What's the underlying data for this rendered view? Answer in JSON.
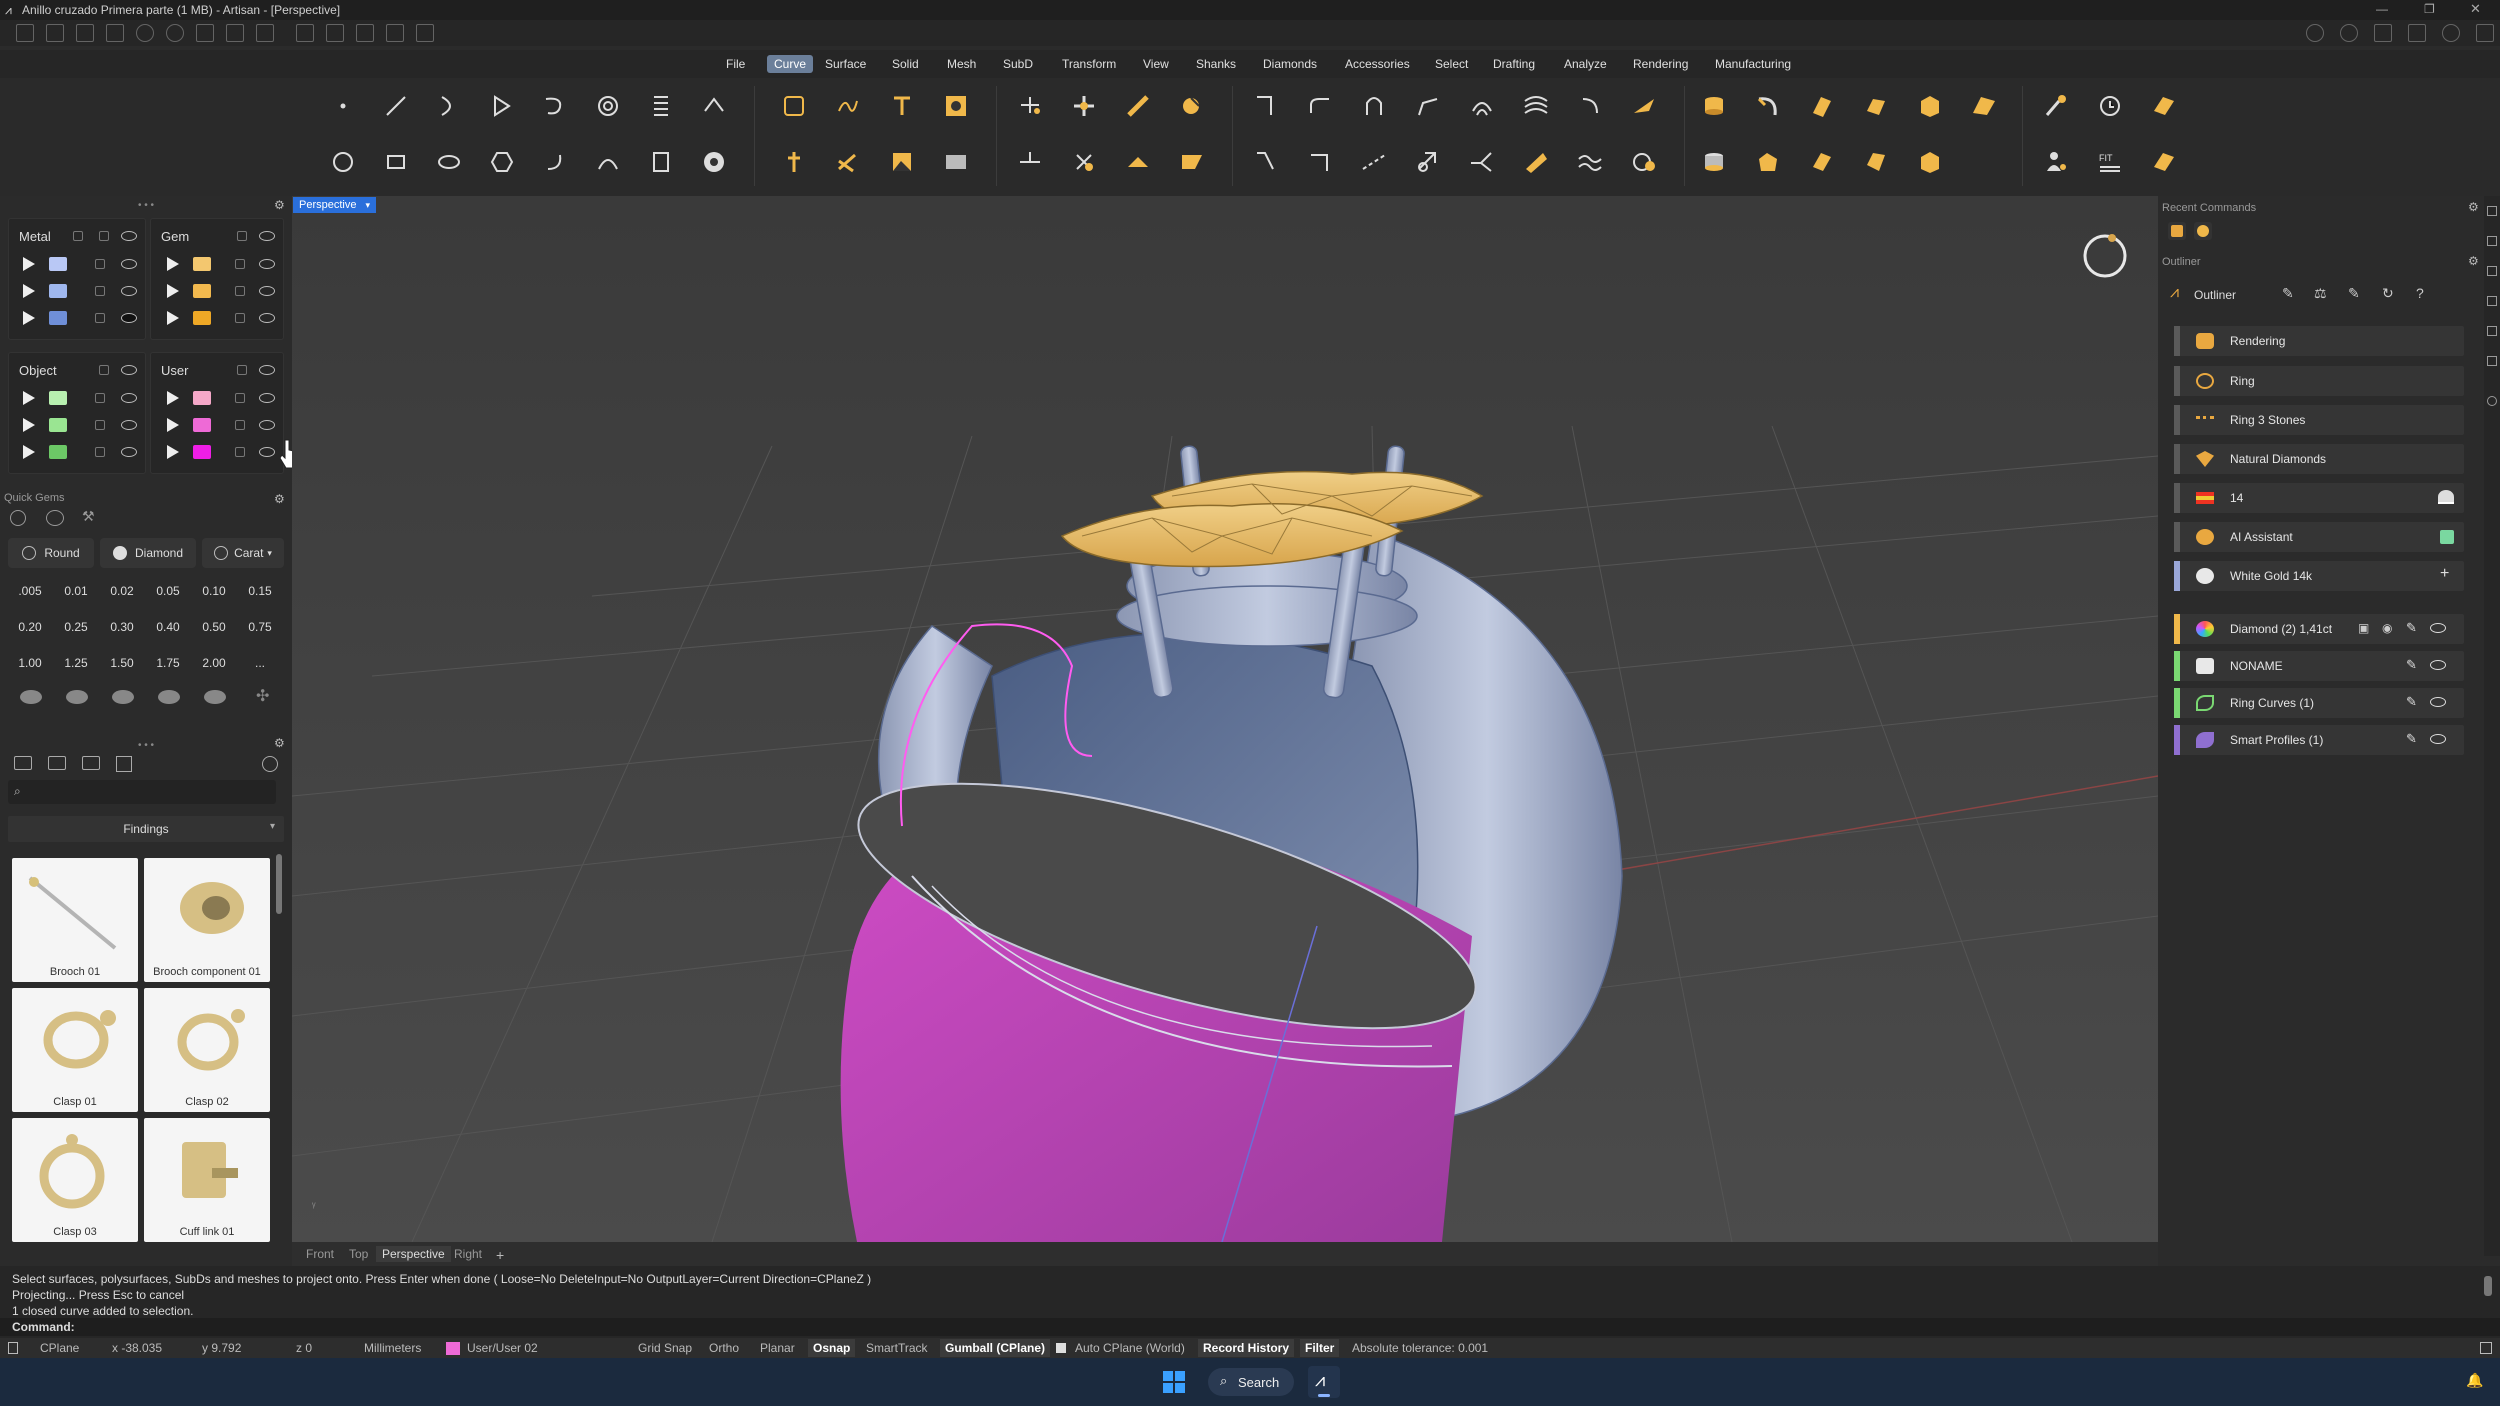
{
  "window": {
    "title": "Anillo cruzado Primera parte (1 MB) - Artisan - [Perspective]"
  },
  "menu": [
    "File",
    "Curve",
    "Surface",
    "Solid",
    "Mesh",
    "SubD",
    "Transform",
    "View",
    "Shanks",
    "Diamonds",
    "Accessories",
    "Select",
    "Drafting",
    "Analyze",
    "Rendering",
    "Manufacturing"
  ],
  "menu_active": "Curve",
  "layers": {
    "metal": {
      "title": "Metal",
      "colors": [
        "#b9c8f5",
        "#9fb7ee",
        "#6f8fd8"
      ]
    },
    "gem": {
      "title": "Gem",
      "colors": [
        "#f3c76f",
        "#f2b94e",
        "#eea826"
      ]
    },
    "object": {
      "title": "Object",
      "colors": [
        "#b8f0b0",
        "#9ae592",
        "#6cc866"
      ]
    },
    "user": {
      "title": "User",
      "colors": [
        "#f5a8c8",
        "#ee6ad6",
        "#ee1ee6"
      ]
    }
  },
  "quick_gems": {
    "title": "Quick Gems",
    "shape": "Round",
    "material": "Diamond",
    "unit": "Carat",
    "sizes": [
      ".005",
      "0.01",
      "0.02",
      "0.05",
      "0.10",
      "0.15",
      "0.20",
      "0.25",
      "0.30",
      "0.40",
      "0.50",
      "0.75",
      "1.00",
      "1.25",
      "1.50",
      "1.75",
      "2.00",
      "..."
    ]
  },
  "library": {
    "category": "Findings",
    "items": [
      "Brooch 01",
      "Brooch component 01",
      "Clasp 01",
      "Clasp 02",
      "Clasp 03",
      "Cuff link 01"
    ]
  },
  "viewport": {
    "label": "Perspective"
  },
  "view_tabs": [
    "Front",
    "Top",
    "Perspective",
    "Right"
  ],
  "view_tab_active": "Perspective",
  "right": {
    "recent_commands": "Recent Commands",
    "outliner_section": "Outliner",
    "outliner_title": "Outliner",
    "rows1": [
      {
        "label": "Rendering",
        "bar": "#5a5a5a"
      },
      {
        "label": "Ring",
        "bar": "#5a5a5a"
      },
      {
        "label": "Ring 3 Stones",
        "bar": "#5a5a5a"
      },
      {
        "label": "Natural Diamonds",
        "bar": "#5a5a5a"
      },
      {
        "label": "14",
        "bar": "#5a5a5a"
      },
      {
        "label": "AI Assistant",
        "bar": "#5a5a5a"
      },
      {
        "label": "White Gold 14k",
        "bar": "#9aa7d8"
      }
    ],
    "rows2": [
      {
        "label": "Diamond (2) 1,41ct",
        "bar": "#f0b84a"
      },
      {
        "label": "NONAME",
        "bar": "#7ad872"
      },
      {
        "label": "Ring Curves (1)",
        "bar": "#7ad872"
      },
      {
        "label": "Smart Profiles (1)",
        "bar": "#8f6fd0"
      }
    ]
  },
  "command": {
    "history": [
      "Select surfaces, polysurfaces, SubDs and meshes to project onto. Press Enter when done ( Loose=No  DeleteInput=No  OutputLayer=Current  Direction=CPlaneZ )",
      "Projecting... Press Esc to cancel",
      "1 closed curve added to selection."
    ],
    "prompt": "Command:"
  },
  "status": {
    "cplane": "CPlane",
    "x": "x -38.035",
    "y": "y 9.792",
    "z": "z 0",
    "units": "Millimeters",
    "layer": "User/User 02",
    "layer_color": "#ee6ad6",
    "grid_snap": "Grid Snap",
    "ortho": "Ortho",
    "planar": "Planar",
    "osnap": "Osnap",
    "smarttrack": "SmartTrack",
    "gumball": "Gumball (CPlane)",
    "auto_cplane": "Auto CPlane (World)",
    "record_history": "Record History",
    "filter": "Filter",
    "tolerance": "Absolute tolerance: 0.001"
  },
  "taskbar": {
    "search": "Search"
  }
}
